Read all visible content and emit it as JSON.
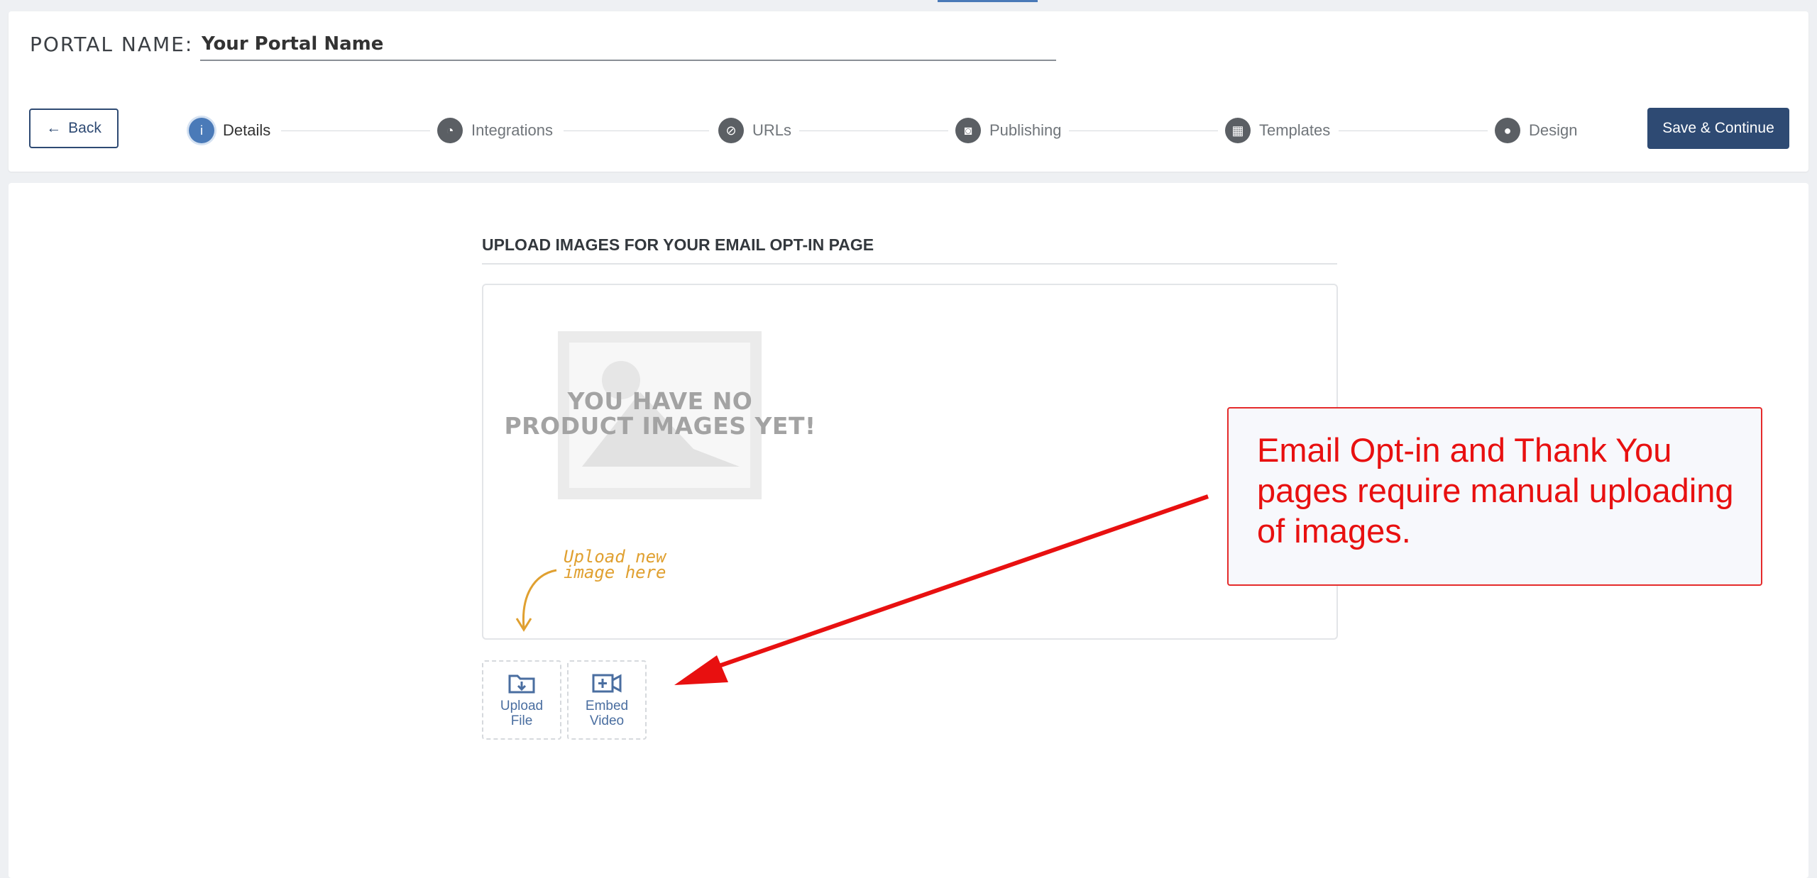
{
  "header": {
    "portal_label": "PORTAL NAME:",
    "portal_name_value": "Your Portal Name",
    "back_label": "Back",
    "save_label": "Save & Continue"
  },
  "steps": [
    {
      "label": "Details",
      "icon": "info-icon",
      "active": true
    },
    {
      "label": "Integrations",
      "icon": "pie-chart-icon",
      "active": false
    },
    {
      "label": "URLs",
      "icon": "link-icon",
      "active": false
    },
    {
      "label": "Publishing",
      "icon": "publish-icon",
      "active": false
    },
    {
      "label": "Templates",
      "icon": "templates-icon",
      "active": false
    },
    {
      "label": "Design",
      "icon": "palette-icon",
      "active": false
    }
  ],
  "upload": {
    "section_title": "UPLOAD IMAGES FOR YOUR EMAIL OPT-IN PAGE",
    "empty_line1": "YOU HAVE NO",
    "empty_line2": "PRODUCT IMAGES YET!",
    "hint_line1": "Upload new",
    "hint_line2": "image here",
    "upload_file_label_1": "Upload",
    "upload_file_label_2": "File",
    "embed_video_label_1": "Embed",
    "embed_video_label_2": "Video"
  },
  "callout": {
    "line1": "Email Opt-in and Thank You",
    "line2": "pages require manual uploading",
    "line3": "of images."
  },
  "colors": {
    "accent": "#2e4a73",
    "active_step": "#4a7ab8",
    "callout_red": "#e81010",
    "hint": "#e0a030"
  }
}
